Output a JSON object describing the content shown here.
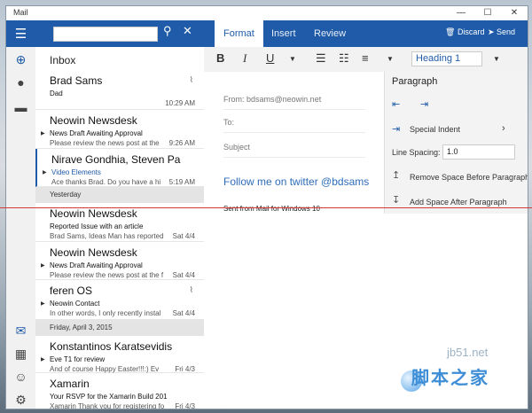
{
  "app": {
    "title": "Mail"
  },
  "window_controls": {
    "minimize": "—",
    "maximize": "☐",
    "close": "✕"
  },
  "search": {
    "value": "",
    "placeholder": ""
  },
  "list": {
    "header": "Inbox",
    "messages": [
      {
        "from": "Brad Sams",
        "subject": "Dad",
        "preview": "",
        "time": "10:29 AM",
        "attachment": true
      },
      {
        "from": "Neowin Newsdesk",
        "subject": "News Draft Awaiting Approval",
        "preview": "Please review the news post at the",
        "time": "9:26 AM"
      },
      {
        "from": "Nirave Gondhia, Steven Pa",
        "subject": "Video Elements",
        "preview": "Ace thanks Brad. Do you have a hi",
        "time": "5:19 AM"
      },
      {
        "from": "Neowin Newsdesk",
        "subject": "Reported Issue with an article",
        "preview": "Brad Sams, Ideas Man has reported",
        "time": "Sat 4/4"
      },
      {
        "from": "Neowin Newsdesk",
        "subject": "News Draft Awaiting Approval",
        "preview": "Please review the news post at the f",
        "time": "Sat 4/4"
      },
      {
        "from": "feren OS",
        "subject": "Neowin Contact",
        "preview": "In other words, I only recently instal",
        "time": "Sat 4/4",
        "attachment": true
      },
      {
        "from": "Konstantinos Karatsevidis",
        "subject": "Eve T1 for review",
        "preview": "And of course Happy Easter!!!:) Ev",
        "time": "Fri 4/3"
      },
      {
        "from": "Xamarin",
        "subject": "Your RSVP for the Xamarin Build 201",
        "preview": "Xamarin Thank you for registering fo",
        "time": "Fri 4/3"
      }
    ],
    "groups": [
      "Yesterday",
      "Friday, April 3, 2015"
    ]
  },
  "ribbon": {
    "tabs": [
      "Format",
      "Insert",
      "Review"
    ],
    "discard_label": "Discard",
    "send_label": "Send"
  },
  "toolbar": {
    "bold": "B",
    "italic": "I",
    "underline": "U",
    "style_value": "Heading 1"
  },
  "compose": {
    "from_label": "From:",
    "from_value": "bdsams@neowin.net",
    "to_label": "To:",
    "subject_placeholder": "Subject",
    "body": "Follow me on twitter @bdsams",
    "signature": "Sent from Mail for Windows 10"
  },
  "paragraph_pane": {
    "title": "Paragraph",
    "special_indent": "Special Indent",
    "line_spacing_label": "Line Spacing:",
    "line_spacing_value": "1.0",
    "remove_space": "Remove Space Before Paragraph",
    "add_space": "Add Space After Paragraph"
  },
  "watermark": {
    "text": "脚本之家",
    "url": "jb51.net"
  },
  "colors": {
    "accent": "#1f5ba8"
  }
}
